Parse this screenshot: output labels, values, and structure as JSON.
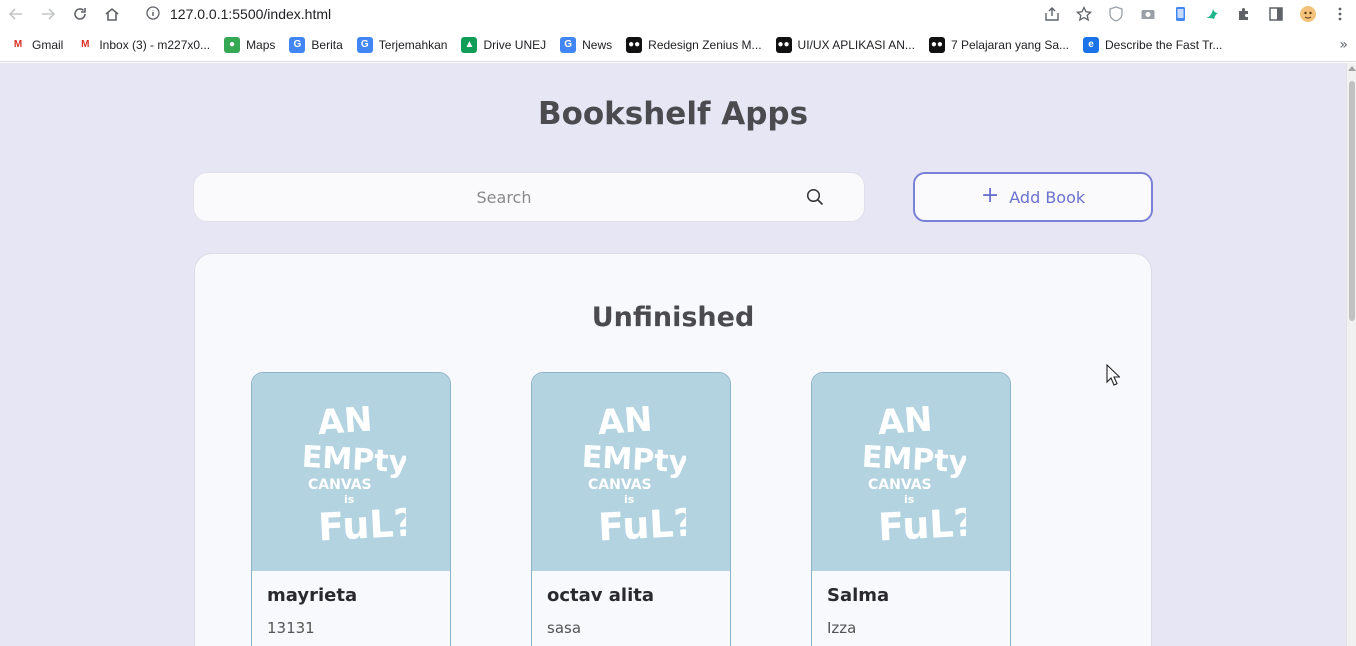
{
  "browser": {
    "url": "127.0.0.1:5500/index.html",
    "bookmarks": [
      {
        "label": "Gmail",
        "icon": "gmail-icon",
        "color": "#d93025",
        "glyph": "M"
      },
      {
        "label": "Inbox (3) - m227x0...",
        "icon": "gmail-icon",
        "color": "#d93025",
        "glyph": "M"
      },
      {
        "label": "Maps",
        "icon": "maps-pin-icon",
        "color": "#34a853",
        "glyph": "●"
      },
      {
        "label": "Berita",
        "icon": "news-icon",
        "color": "#4285f4",
        "glyph": "G"
      },
      {
        "label": "Terjemahkan",
        "icon": "translate-icon",
        "color": "#4285f4",
        "glyph": "G"
      },
      {
        "label": "Drive UNEJ",
        "icon": "drive-icon",
        "color": "#0f9d58",
        "glyph": "▲"
      },
      {
        "label": "News",
        "icon": "news-icon",
        "color": "#4285f4",
        "glyph": "G"
      },
      {
        "label": "Redesign Zenius M...",
        "icon": "medium-icon",
        "color": "#111111",
        "glyph": "●●"
      },
      {
        "label": "UI/UX APLIKASI AN...",
        "icon": "medium-icon",
        "color": "#111111",
        "glyph": "●●"
      },
      {
        "label": "7 Pelajaran yang Sa...",
        "icon": "medium-icon",
        "color": "#111111",
        "glyph": "●●"
      },
      {
        "label": "Describe the Fast Tr...",
        "icon": "edge-icon",
        "color": "#1a73e8",
        "glyph": "e"
      }
    ]
  },
  "app": {
    "title": "Bookshelf Apps",
    "search_placeholder": "Search",
    "add_book_label": "Add Book"
  },
  "unfinished": {
    "title": "Unfinished",
    "books": [
      {
        "title": "mayrieta",
        "author": "13131"
      },
      {
        "title": "octav alita",
        "author": "sasa"
      },
      {
        "title": "Salma",
        "author": "Izza"
      }
    ]
  },
  "cover_art": {
    "lettering": "AN EMPTY CANVAS IS FULL?",
    "background": "#b3d3e0"
  },
  "colors": {
    "page_bg": "#e7e6f4",
    "accent": "#6b71d0",
    "card_border": "#8fb3cc"
  }
}
